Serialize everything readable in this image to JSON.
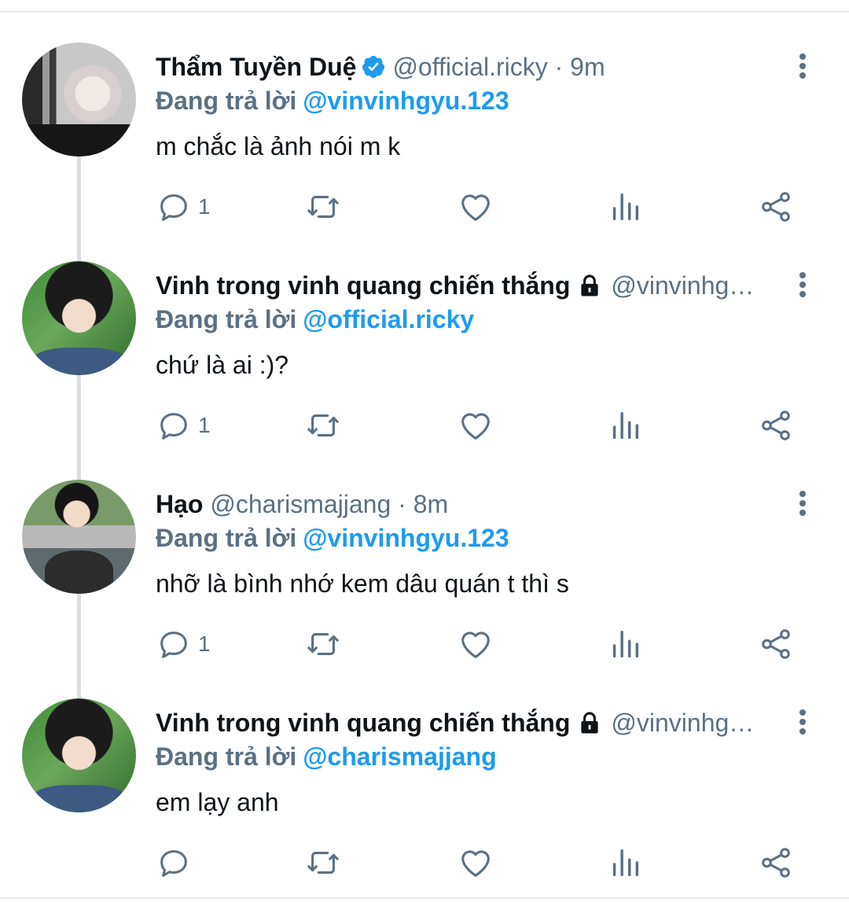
{
  "tweets": [
    {
      "name": "Thẩm Tuyền Duệ",
      "verified": true,
      "protected": false,
      "handle": "@official.ricky",
      "separator": "·",
      "time": "9m",
      "replying_label": "Đang trả lời",
      "reply_to": "@vinvinhgyu.123",
      "text": "m chắc là ảnh nói m k",
      "reply_count": "1"
    },
    {
      "name": "Vinh trong vinh quang chiến thắng",
      "verified": false,
      "protected": true,
      "handle": "@vinvinhg…",
      "separator": "",
      "time": "",
      "replying_label": "Đang trả lời",
      "reply_to": "@official.ricky",
      "text": "chứ là ai :)?",
      "reply_count": "1"
    },
    {
      "name": "Hạo",
      "verified": false,
      "protected": false,
      "handle": "@charismajjang",
      "separator": "·",
      "time": "8m",
      "replying_label": "Đang trả lời",
      "reply_to": "@vinvinhgyu.123",
      "text": "nhỡ là bình nhớ kem dâu quán t thì s",
      "reply_count": "1"
    },
    {
      "name": "Vinh trong vinh quang chiến thắng",
      "verified": false,
      "protected": true,
      "handle": "@vinvinhg…",
      "separator": "",
      "time": "",
      "replying_label": "Đang trả lời",
      "reply_to": "@charismajjang",
      "text": "em lạy anh",
      "reply_count": ""
    }
  ],
  "icons": {
    "reply": "reply-icon",
    "retweet": "retweet-icon",
    "like": "heart-icon",
    "analytics": "analytics-icon",
    "share": "share-icon",
    "more": "more-vertical-icon",
    "verified": "verified-badge-icon",
    "protected": "lock-icon"
  },
  "colors": {
    "accent": "#1d9bf0",
    "secondary_text": "#5b7083",
    "primary_text": "#0f1419",
    "divider": "#e6e8ea",
    "thread_line": "#d9dde0"
  }
}
